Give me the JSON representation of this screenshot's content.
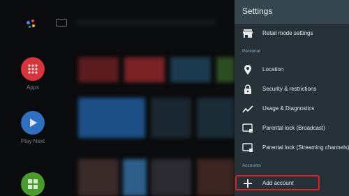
{
  "home": {
    "apps_label": "Apps",
    "play_next_label": "Play Next"
  },
  "settings": {
    "title": "Settings",
    "retail_mode": "Retail mode settings",
    "section_personal": "Personal",
    "location": "Location",
    "security": "Security & restrictions",
    "usage": "Usage & Diagnostics",
    "parental_broadcast": "Parental lock (Broadcast)",
    "parental_streaming": "Parental lock (Streaming channels)",
    "section_accounts": "Accounts",
    "add_account": "Add account"
  },
  "colors": {
    "panel": "#263238",
    "header": "#37474f",
    "focus": "#e01e26",
    "apps_red": "#d7353b",
    "play_blue": "#2e6fc2",
    "green": "#4b9a2c"
  }
}
